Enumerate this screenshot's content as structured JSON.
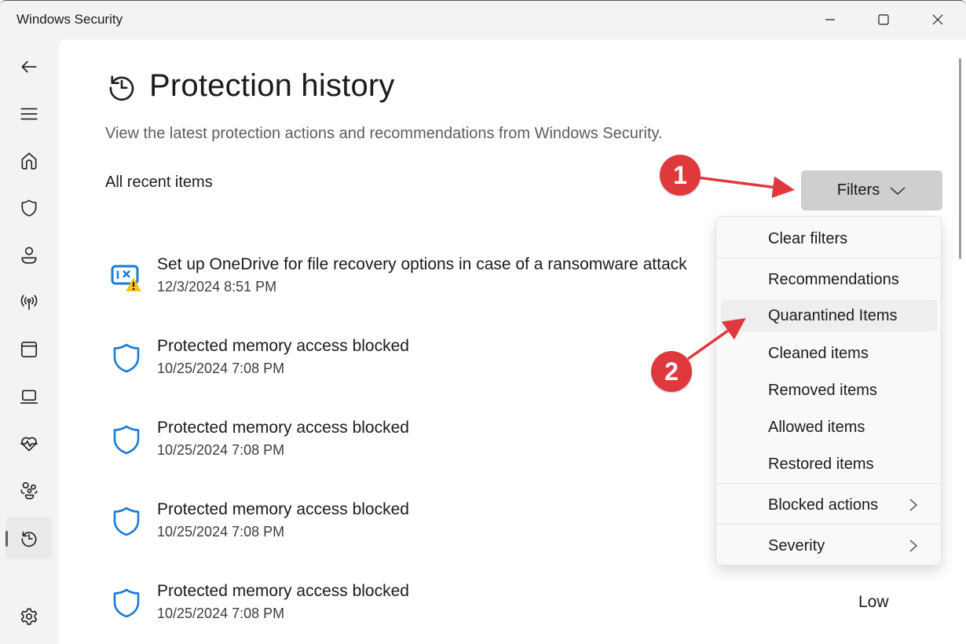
{
  "window": {
    "title": "Windows Security",
    "controls": {
      "minimize": "minimize-icon",
      "maximize": "maximize-icon",
      "close": "close-icon"
    }
  },
  "sidebar": {
    "items": [
      {
        "id": "back",
        "icon": "back-arrow-icon"
      },
      {
        "id": "menu",
        "icon": "hamburger-menu-icon"
      },
      {
        "id": "home",
        "icon": "home-icon"
      },
      {
        "id": "virus-protection",
        "icon": "shield-icon"
      },
      {
        "id": "account-protection",
        "icon": "person-icon"
      },
      {
        "id": "firewall-network",
        "icon": "wireless-antenna-icon"
      },
      {
        "id": "app-browser-control",
        "icon": "app-window-icon"
      },
      {
        "id": "device-security",
        "icon": "laptop-icon"
      },
      {
        "id": "device-performance",
        "icon": "heart-pulse-icon"
      },
      {
        "id": "family-options",
        "icon": "family-icon"
      },
      {
        "id": "protection-history",
        "icon": "history-icon",
        "active": true
      },
      {
        "id": "settings",
        "icon": "gear-icon"
      }
    ]
  },
  "page": {
    "icon": "history-icon",
    "title": "Protection history",
    "description": "View the latest protection actions and recommendations from Windows Security.",
    "section_label": "All recent items",
    "filters_label": "Filters"
  },
  "items": [
    {
      "icon": "onedrive-warning-icon",
      "title": "Set up OneDrive for file recovery options in case of a ransomware attack",
      "date": "12/3/2024 8:51 PM"
    },
    {
      "icon": "shield-icon",
      "title": "Protected memory access blocked",
      "date": "10/25/2024 7:08 PM"
    },
    {
      "icon": "shield-icon",
      "title": "Protected memory access blocked",
      "date": "10/25/2024 7:08 PM"
    },
    {
      "icon": "shield-icon",
      "title": "Protected memory access blocked",
      "date": "10/25/2024 7:08 PM"
    },
    {
      "icon": "shield-icon",
      "title": "Protected memory access blocked",
      "date": "10/25/2024 7:08 PM",
      "severity": "Low"
    }
  ],
  "filter_menu": {
    "items": [
      {
        "label": "Clear filters"
      },
      {
        "label": "Recommendations"
      },
      {
        "label": "Quarantined Items",
        "hovered": true
      },
      {
        "label": "Cleaned items"
      },
      {
        "label": "Removed items"
      },
      {
        "label": "Allowed items"
      },
      {
        "label": "Restored items"
      },
      {
        "label": "Blocked actions",
        "submenu": true
      },
      {
        "label": "Severity",
        "submenu": true
      }
    ]
  },
  "annotations": {
    "badge_1": "1",
    "badge_2": "2",
    "color": "#e0393d"
  },
  "colors": {
    "accent_blue": "#1a7bd6",
    "warning_yellow": "#f7c21b",
    "filters_button_bg": "#cfcfcf"
  }
}
